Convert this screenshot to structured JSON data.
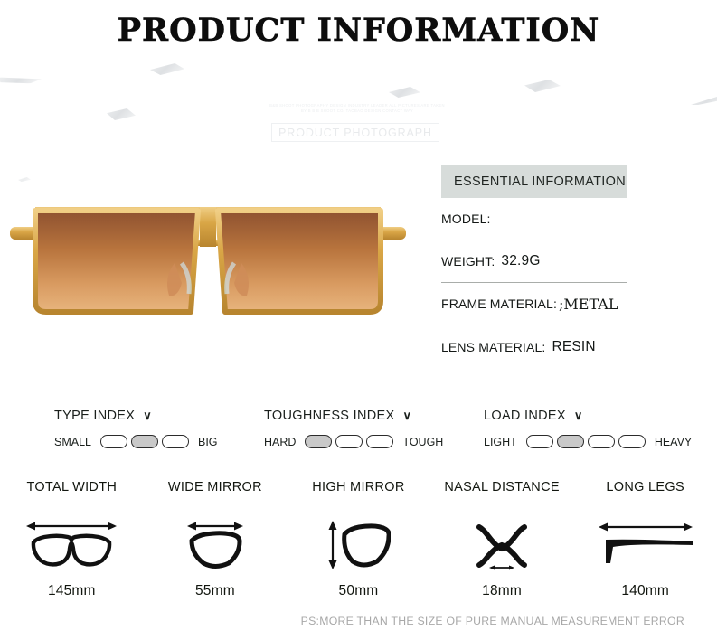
{
  "page": {
    "title": "PRODUCT INFORMATION",
    "background_color": "#ffffff"
  },
  "watermark": {
    "line1": "B&B SHOOT PHOTOGRAPHY DESIGN INDUSTRY LEADER ALL PICTURES ARE TAKEN",
    "line2": "BY B B B SHOOT CO/ TAOBAO DESIGN CONTACT WAY",
    "box_label": "PRODUCT PHOTOGRAPH"
  },
  "product_image": {
    "alt": "gold frame square aviator sunglasses with brown gradient lenses",
    "frame_color": "#d8a33f",
    "lens_top_color": "#9a5a32",
    "lens_bottom_color": "#e2a86e"
  },
  "essential_information": {
    "heading": "ESSENTIAL INFORMATION",
    "heading_bg": "#d7dcda",
    "rows": [
      {
        "key": "MODEL:",
        "value": ""
      },
      {
        "key": "WEIGHT:",
        "value": "32.9G"
      },
      {
        "key": "FRAME MATERIAL:",
        "value": ";METAL"
      },
      {
        "key": "LENS MATERIAL:",
        "value": "RESIN"
      }
    ]
  },
  "indices": [
    {
      "title": "TYPE INDEX",
      "chevron": "∨",
      "left_label": "SMALL",
      "right_label": "BIG",
      "segments": 3,
      "active": 2
    },
    {
      "title": "TOUGHNESS INDEX",
      "chevron": "∨",
      "left_label": "HARD",
      "right_label": "TOUGH",
      "segments": 3,
      "active": 1
    },
    {
      "title": "LOAD INDEX",
      "chevron": "∨",
      "left_label": "LIGHT",
      "right_label": "HEAVY",
      "segments": 4,
      "active": 2
    }
  ],
  "measurements": [
    {
      "label": "TOTAL WIDTH",
      "value": "145mm",
      "icon": "full-frame-width-icon"
    },
    {
      "label": "WIDE MIRROR",
      "value": "55mm",
      "icon": "single-lens-width-icon"
    },
    {
      "label": "HIGH MIRROR",
      "value": "50mm",
      "icon": "single-lens-height-icon"
    },
    {
      "label": "NASAL DISTANCE",
      "value": "18mm",
      "icon": "bridge-width-icon"
    },
    {
      "label": "LONG LEGS",
      "value": "140mm",
      "icon": "temple-length-icon"
    }
  ],
  "footer_note": "PS:MORE THAN THE SIZE OF PURE MANUAL MEASUREMENT ERROR"
}
